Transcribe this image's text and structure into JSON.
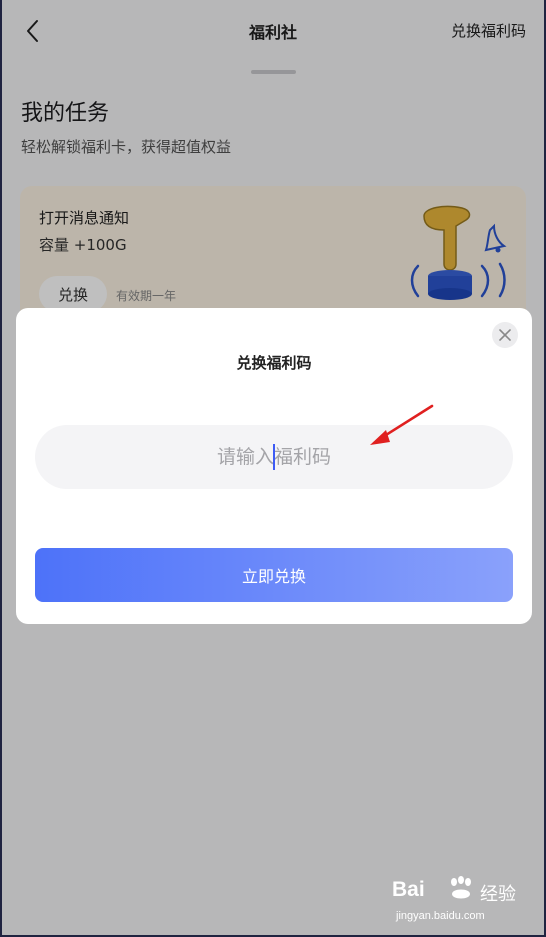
{
  "header": {
    "title": "福利社",
    "action_label": "兑换福利码"
  },
  "section": {
    "title": "我的任务",
    "subtitle": "轻松解锁福利卡，获得超值权益"
  },
  "task": {
    "name": "打开消息通知",
    "reward": "容量 +100G",
    "button_label": "兑换",
    "validity": "有效期一年"
  },
  "dialog": {
    "title": "兑换福利码",
    "input_placeholder": "请输入福利码",
    "input_value": "",
    "submit_label": "立即兑换"
  },
  "watermark": {
    "brand": "Bai",
    "brand_suffix": "经验",
    "url": "jingyan.baidu.com"
  },
  "colors": {
    "accent_start": "#4d72f9",
    "accent_end": "#8aa1fb",
    "card_bg": "#fbf2e3",
    "annotation_arrow": "#e02020"
  },
  "icons": {
    "back": "chevron-left-icon",
    "close": "close-icon",
    "illustration": "hand-pressing-bell-icon",
    "annotation": "red-arrow-icon"
  }
}
